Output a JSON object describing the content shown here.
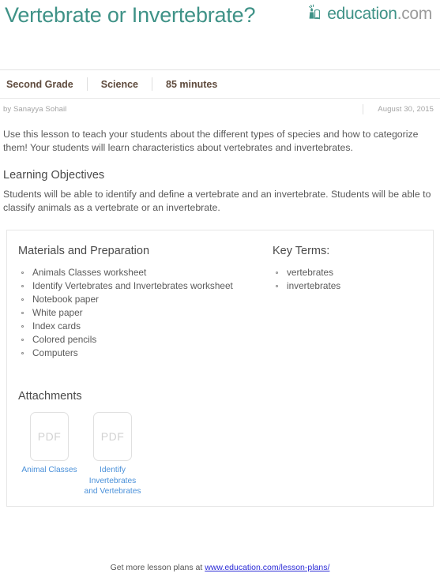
{
  "header": {
    "title": "Vertebrate or Invertebrate?",
    "logo": {
      "icon": "person-reading-book-icon",
      "word": "education",
      "tld": ".com"
    }
  },
  "meta": {
    "grade": "Second Grade",
    "subject": "Science",
    "duration": "85 minutes"
  },
  "byline": {
    "author": "by Sanayya Sohail",
    "date": "August 30, 2015"
  },
  "intro": "Use this lesson to teach your students about the different types of species and how to categorize them! Your students will learn characteristics about vertebrates and invertebrates.",
  "objectives": {
    "heading": "Learning Objectives",
    "body": "Students will be able to identify and define a vertebrate and an invertebrate. Students will be able to classify animals as a vertebrate or an invertebrate."
  },
  "materials": {
    "heading": "Materials and Preparation",
    "items": [
      "Animals Classes worksheet",
      "Identify Vertebrates and Invertebrates worksheet",
      "Notebook paper",
      "White paper",
      "Index cards",
      "Colored pencils",
      "Computers"
    ]
  },
  "key_terms": {
    "heading": "Key Terms:",
    "items": [
      "vertebrates",
      "invertebrates"
    ]
  },
  "attachments": {
    "heading": "Attachments",
    "items": [
      {
        "type_label": "PDF",
        "caption": "Animal Classes"
      },
      {
        "type_label": "PDF",
        "caption": "Identify Invertebrates and Vertebrates"
      }
    ]
  },
  "footer": {
    "prefix": "Get more lesson plans at ",
    "link_text": "www.education.com/lesson-plans/"
  },
  "colors": {
    "brand_teal": "#3f9287",
    "meta_brown": "#5e4a3c",
    "link_blue": "#4a90d9",
    "footer_link": "#2b2bd6",
    "border_gray": "#e6e6e6"
  }
}
